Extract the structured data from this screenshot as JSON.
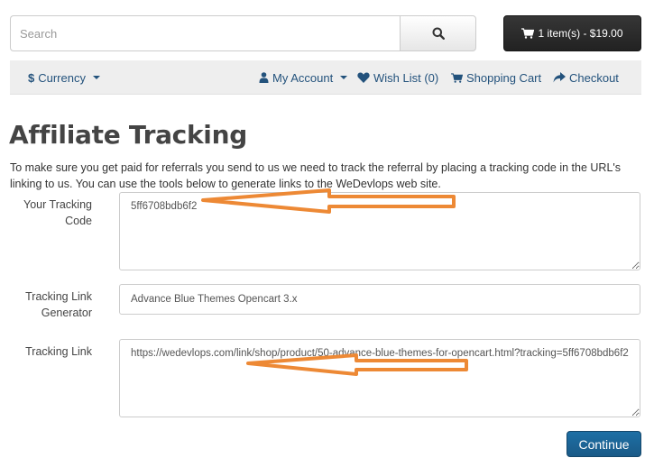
{
  "header": {
    "search": {
      "placeholder": "Search",
      "value": "",
      "button_icon": "search-icon"
    },
    "cart_button": {
      "icon": "shopping-cart-icon",
      "label": "1 item(s) - $19.00"
    }
  },
  "topbar": {
    "currency": {
      "icon_text": "$",
      "label": "Currency"
    },
    "links": [
      {
        "icon": "user-icon",
        "label": "My Account",
        "dropdown": true
      },
      {
        "icon": "heart-icon",
        "label": "Wish List (0)"
      },
      {
        "icon": "shopping-cart-icon",
        "label": "Shopping Cart"
      },
      {
        "icon": "share-icon",
        "label": "Checkout"
      }
    ]
  },
  "page": {
    "title": "Affiliate Tracking",
    "intro": "To make sure you get paid for referrals you send to us we need to track the referral by placing a tracking code in the URL's linking to us. You can use the tools below to generate links to the WeDevlops web site.",
    "fields": {
      "tracking_code": {
        "label": "Your Tracking Code",
        "value": "5ff6708bdb6f2"
      },
      "link_generator": {
        "label": "Tracking Link Generator",
        "value": "Advance Blue Themes Opencart 3.x"
      },
      "tracking_link": {
        "label": "Tracking Link",
        "value": "https://wedevlops.com/link/shop/product/50-advance-blue-themes-for-opencart.html?tracking=5ff6708bdb6f2"
      }
    },
    "continue_label": "Continue"
  },
  "annotations": {
    "arrow_color": "#ed8935"
  },
  "colors": {
    "link": "#23527c",
    "primary": "#1e6fa5",
    "cart_bg": "#2b2b2b",
    "bar_bg": "#eeeeee"
  }
}
